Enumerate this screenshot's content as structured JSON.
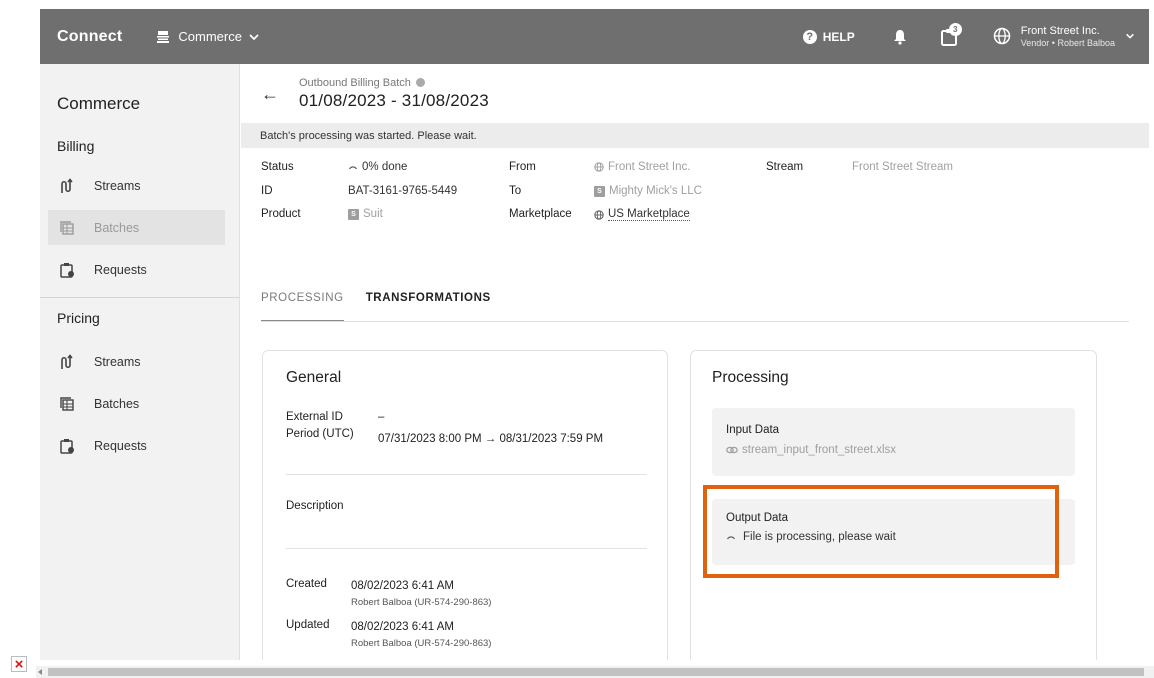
{
  "topbar": {
    "brand": "Connect",
    "module": "Commerce",
    "help": "HELP",
    "tasks_count": "3",
    "account_name": "Front Street Inc.",
    "account_role": "Vendor • Robert Balboa"
  },
  "sidebar": {
    "title": "Commerce",
    "sections": [
      {
        "title": "Billing",
        "items": [
          {
            "label": "Streams"
          },
          {
            "label": "Batches"
          },
          {
            "label": "Requests"
          }
        ]
      },
      {
        "title": "Pricing",
        "items": [
          {
            "label": "Streams"
          },
          {
            "label": "Batches"
          },
          {
            "label": "Requests"
          }
        ]
      }
    ]
  },
  "header": {
    "subtitle": "Outbound Billing Batch",
    "title": "01/08/2023 - 31/08/2023"
  },
  "notice": "Batch's processing was started. Please wait.",
  "props": {
    "status_label": "Status",
    "status_value": "0% done",
    "id_label": "ID",
    "id_value": "BAT-3161-9765-5449",
    "product_label": "Product",
    "product_value": "Suit",
    "from_label": "From",
    "from_value": "Front Street Inc.",
    "to_label": "To",
    "to_value": "Mighty Mick's LLC",
    "marketplace_label": "Marketplace",
    "marketplace_value": "US Marketplace",
    "stream_label": "Stream",
    "stream_value": "Front Street Stream",
    "badge_letter": "S"
  },
  "tabs": [
    {
      "label": "PROCESSING"
    },
    {
      "label": "TRANSFORMATIONS"
    }
  ],
  "general": {
    "title": "General",
    "external_id_label": "External ID",
    "external_id_value": "–",
    "period_label": "Period (UTC)",
    "period_value": "07/31/2023 8:00 PM → 08/31/2023 7:59 PM",
    "description_label": "Description",
    "created_label": "Created",
    "created_value": "08/02/2023 6:41 AM",
    "created_by": "Robert Balboa (UR-574-290-863)",
    "updated_label": "Updated",
    "updated_value": "08/02/2023 6:41 AM",
    "updated_by": "Robert Balboa (UR-574-290-863)"
  },
  "processing": {
    "title": "Processing",
    "input_label": "Input Data",
    "input_file": "stream_input_front_street.xlsx",
    "output_label": "Output Data",
    "output_status": "File is processing, please wait"
  },
  "colors": {
    "topbar": "#6f6f6f",
    "sidebar": "#f2f2f2",
    "highlight": "#e0620e"
  }
}
